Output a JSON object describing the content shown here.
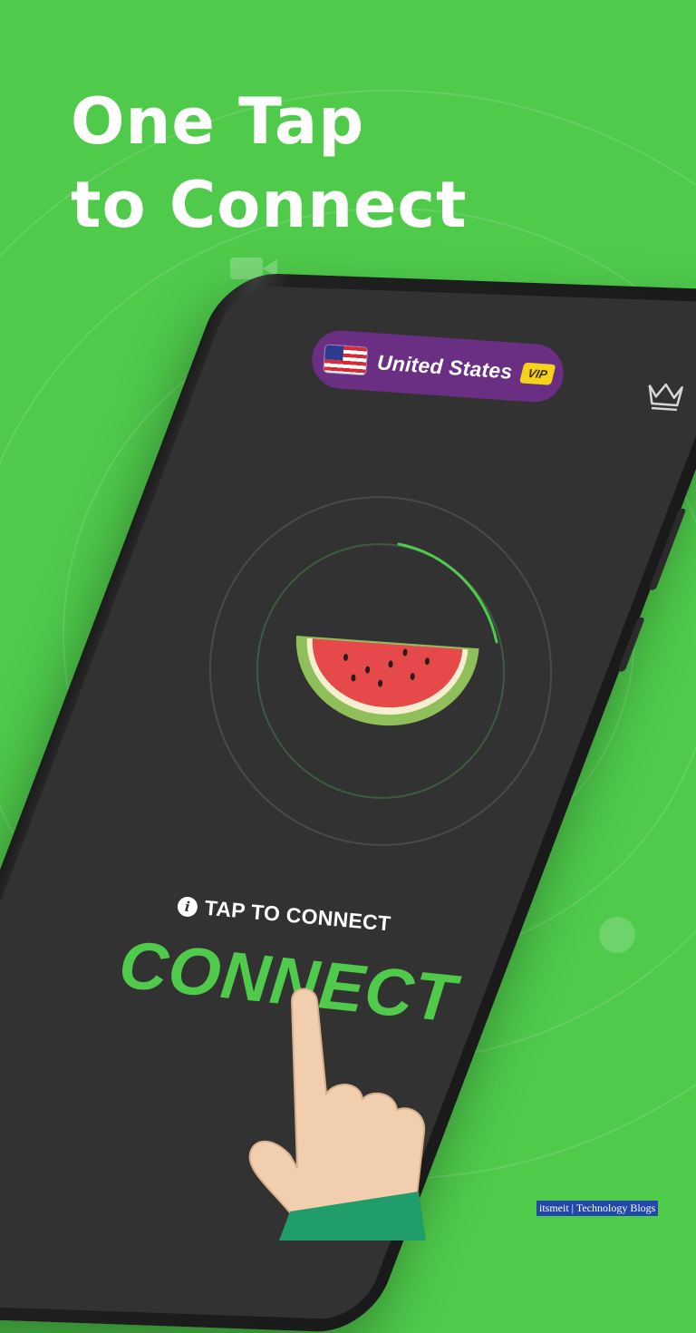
{
  "headline": {
    "line1": "One Tap",
    "line2": "to Connect"
  },
  "server": {
    "country": "United States",
    "flag_icon": "us-flag-icon",
    "badge": "VIP"
  },
  "premium_icon": "crown-icon",
  "hint": {
    "icon": "info-icon",
    "text": "TAP TO CONNECT"
  },
  "connect_label": "CONNECT",
  "watermark": "itsmeit | Technology Blogs",
  "colors": {
    "background": "#4fca4b",
    "screen": "#323232",
    "accent": "#4fca4b",
    "country_pill": "#6a2e82",
    "vip_badge": "#f6d21a"
  }
}
